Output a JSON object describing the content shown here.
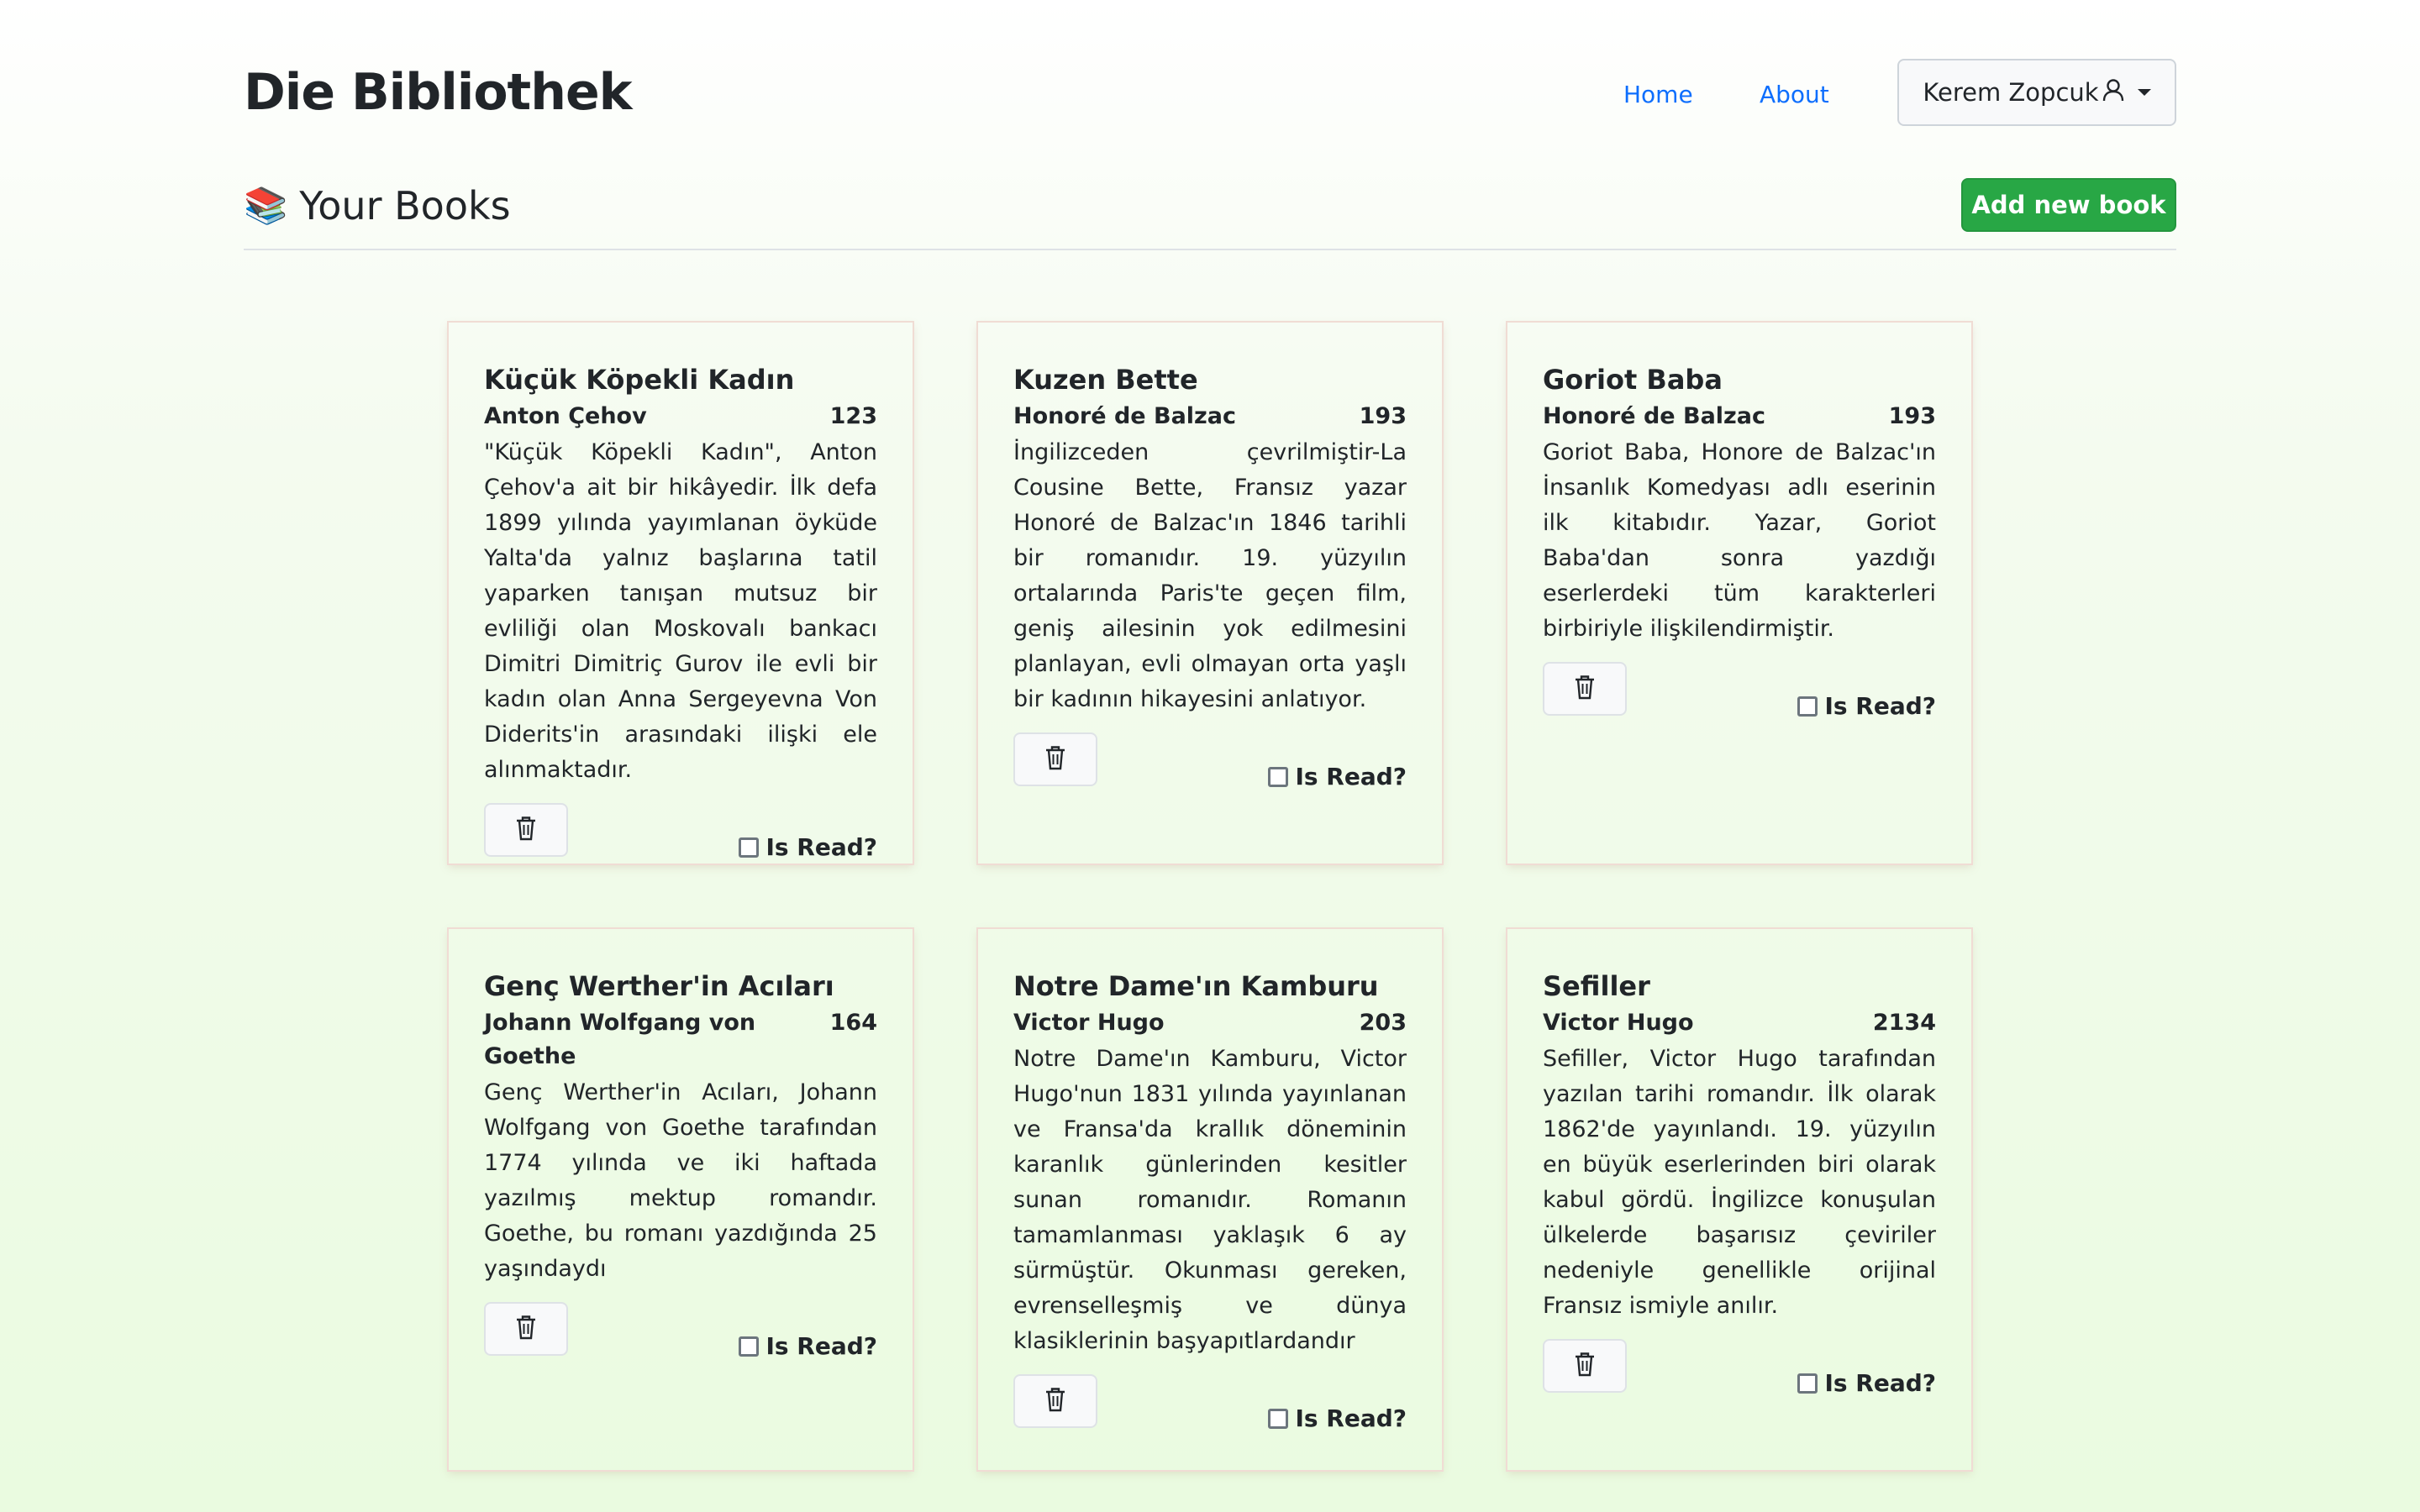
{
  "nav": {
    "brand": "Die Bibliothek",
    "home": "Home",
    "about": "About",
    "user": "Kerem Zopcuk",
    "user_icon": "user-icon",
    "dropdown_icon": "caret-down-icon"
  },
  "header": {
    "icon": "📚",
    "title": "Your Books",
    "add_button": "Add new book",
    "add_button_color": "#28a745"
  },
  "books": [
    {
      "title": "Küçük Köpekli Kadın",
      "author": "Anton Çehov",
      "pages": "123",
      "description": "\"Küçük Köpekli Kadın\", Anton Çehov'a ait bir hikâyedir. İlk defa 1899 yılında yayımlanan öyküde Yalta'da yalnız başlarına tatil yaparken tanışan mutsuz bir evliliği olan Moskovalı bankacı Dimitri Dimitriç Gurov ile evli bir kadın olan Anna Sergeyevna Von Diderits'in arasındaki ilişki ele alınmaktadır.",
      "read_label": "Is Read?",
      "is_read": false
    },
    {
      "title": "Kuzen Bette",
      "author": "Honoré de Balzac",
      "pages": "193",
      "description": "İngilizceden çevrilmiştir-La Cousine Bette, Fransız yazar Honoré de Balzac'ın 1846 tarihli bir romanıdır. 19. yüzyılın ortalarında Paris'te geçen film, geniş ailesinin yok edilmesini planlayan, evli olmayan orta yaşlı bir kadının hikayesini anlatıyor.",
      "read_label": "Is Read?",
      "is_read": false
    },
    {
      "title": "Goriot Baba",
      "author": "Honoré de Balzac",
      "pages": "193",
      "description": "Goriot Baba, Honore de Balzac'ın İnsanlık Komedyası adlı eserinin ilk kitabıdır. Yazar, Goriot Baba'dan sonra yazdığı eserlerdeki tüm karakterleri birbiriyle ilişkilendirmiştir.",
      "read_label": "Is Read?",
      "is_read": false
    },
    {
      "title": "Genç Werther'in Acıları",
      "author": "Johann Wolfgang von Goethe",
      "pages": "164",
      "description": "Genç Werther'in Acıları, Johann Wolfgang von Goethe tarafından 1774 yılında ve iki haftada yazılmış mektup romandır. Goethe, bu romanı yazdığında 25 yaşındaydı",
      "read_label": "Is Read?",
      "is_read": false
    },
    {
      "title": "Notre Dame'ın Kamburu",
      "author": "Victor Hugo",
      "pages": "203",
      "description": "Notre Dame'ın Kamburu, Victor Hugo'nun 1831 yılında yayınlanan ve Fransa'da krallık döneminin karanlık günlerinden kesitler sunan romanıdır. Romanın tamamlanması yaklaşık 6 ay sürmüştür. Okunması gereken, evrenselleşmiş ve dünya klasiklerinin başyapıtlardandır",
      "read_label": "Is Read?",
      "is_read": false
    },
    {
      "title": "Sefiller",
      "author": "Victor Hugo",
      "pages": "2134",
      "description": "Sefiller, Victor Hugo tarafından yazılan tarihi romandır. İlk olarak 1862'de yayınlandı. 19. yüzyılın en büyük eserlerinden biri olarak kabul gördü. İngilizce konuşulan ülkelerde başarısız çeviriler nedeniyle genellikle orijinal Fransız ismiyle anılır.",
      "read_label": "Is Read?",
      "is_read": false
    }
  ],
  "delete_icon": "trash-icon"
}
